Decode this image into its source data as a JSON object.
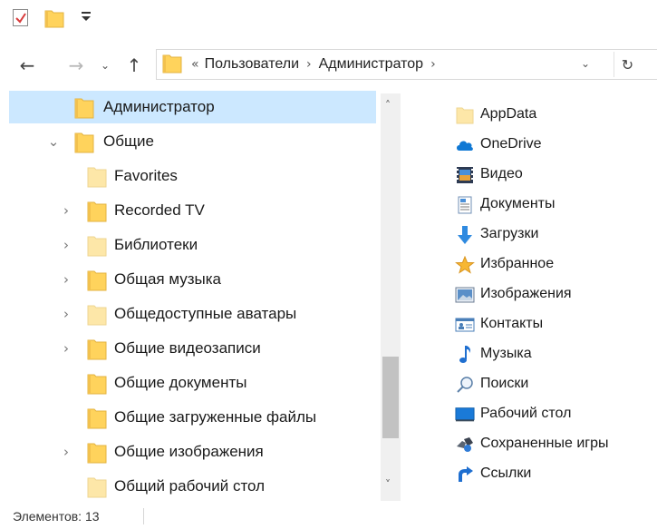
{
  "window": {
    "colors": {
      "selection": "#cce8ff",
      "folder": "#ffd35c",
      "folder_light": "#fde7a8",
      "accent": "#0078d7"
    }
  },
  "quick_access": {
    "icons": [
      "properties-check-icon",
      "new-folder-icon",
      "customize-dropdown-icon"
    ]
  },
  "nav": {
    "back_icon": "←",
    "forward_icon": "→",
    "recent_icon": "⌄",
    "up_icon": "↑",
    "overflow": "«",
    "path": [
      "Пользователи",
      "Администратор"
    ],
    "separator": "›",
    "dropdown_icon": "⌄",
    "refresh_icon": "↻"
  },
  "tree": {
    "items": [
      {
        "label": "Администратор",
        "expander": "",
        "selected": true
      },
      {
        "label": "Общие",
        "expander": "⌄",
        "selected": false
      },
      {
        "label": "Favorites",
        "expander": "",
        "selected": false
      },
      {
        "label": "Recorded TV",
        "expander": "›",
        "selected": false
      },
      {
        "label": "Библиотеки",
        "expander": "›",
        "selected": false
      },
      {
        "label": "Общая музыка",
        "expander": "›",
        "selected": false
      },
      {
        "label": "Общедоступные аватары",
        "expander": "›",
        "selected": false
      },
      {
        "label": "Общие видеозаписи",
        "expander": "›",
        "selected": false
      },
      {
        "label": "Общие документы",
        "expander": "",
        "selected": false
      },
      {
        "label": "Общие загруженные файлы",
        "expander": "",
        "selected": false
      },
      {
        "label": "Общие изображения",
        "expander": "›",
        "selected": false
      },
      {
        "label": "Общий рабочий стол",
        "expander": "",
        "selected": false
      }
    ],
    "scroll_up_icon": "˄",
    "scroll_down_icon": "˅"
  },
  "content": {
    "items": [
      {
        "label": "AppData",
        "icon": "folder-light-icon"
      },
      {
        "label": "OneDrive",
        "icon": "cloud-icon"
      },
      {
        "label": "Видео",
        "icon": "film-icon"
      },
      {
        "label": "Документы",
        "icon": "document-icon"
      },
      {
        "label": "Загрузки",
        "icon": "download-arrow-icon"
      },
      {
        "label": "Избранное",
        "icon": "star-icon"
      },
      {
        "label": "Изображения",
        "icon": "picture-icon"
      },
      {
        "label": "Контакты",
        "icon": "contact-card-icon"
      },
      {
        "label": "Музыка",
        "icon": "music-note-icon"
      },
      {
        "label": "Поиски",
        "icon": "magnifier-icon"
      },
      {
        "label": "Рабочий стол",
        "icon": "desktop-icon"
      },
      {
        "label": "Сохраненные игры",
        "icon": "game-piece-icon"
      },
      {
        "label": "Ссылки",
        "icon": "link-arrow-icon"
      }
    ]
  },
  "status": {
    "items_count": "Элементов: 13"
  }
}
